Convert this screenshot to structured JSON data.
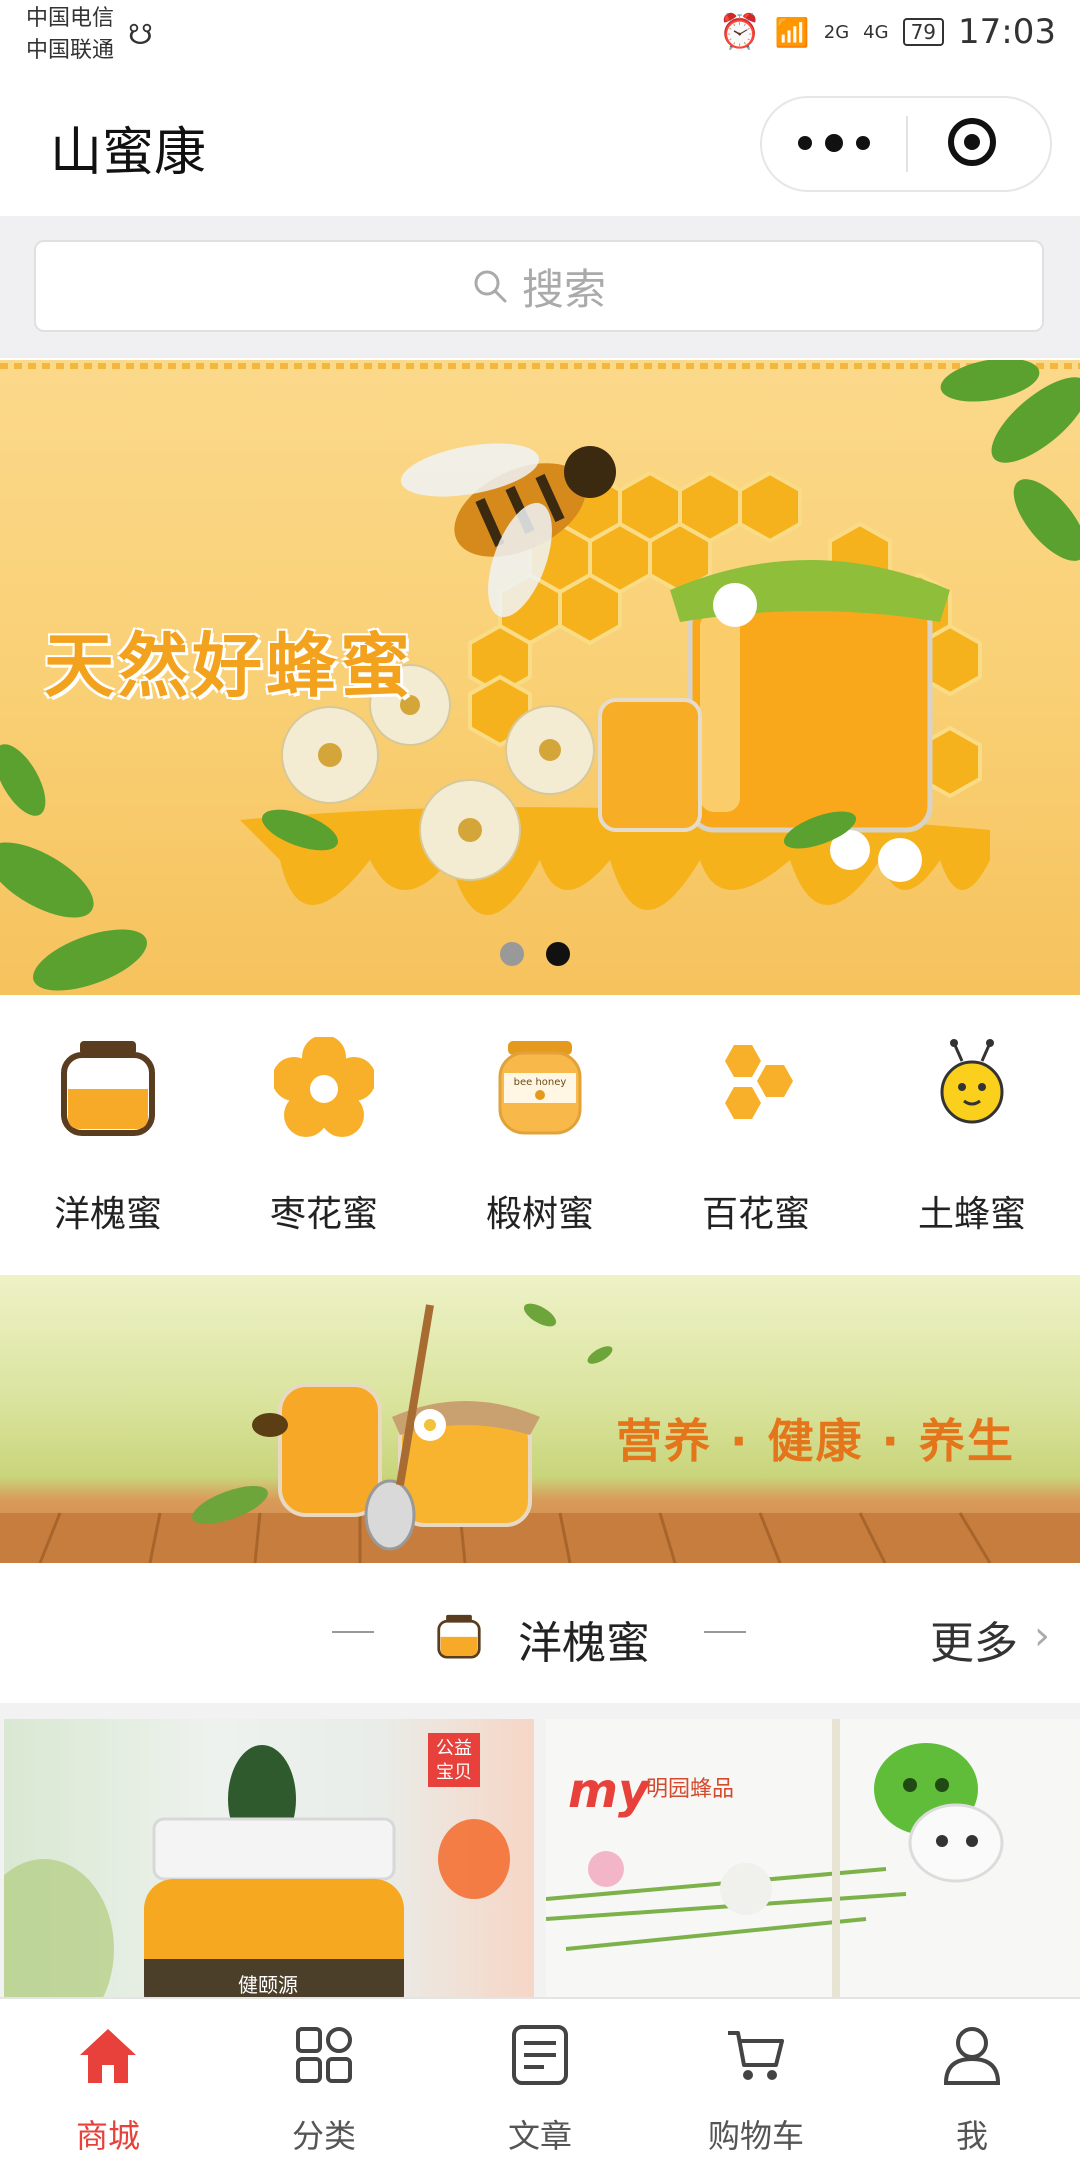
{
  "status_bar": {
    "carrier_1": "中国电信",
    "carrier_2": "中国联通",
    "signal_1": "2G",
    "signal_2": "4G",
    "battery": "79",
    "time": "17:03"
  },
  "title_bar": {
    "title": "山蜜康",
    "menu_icon": "more-dots-icon",
    "close_icon": "target-circle-icon"
  },
  "search": {
    "placeholder": "搜索"
  },
  "banner": {
    "headline": "天然好蜂蜜",
    "slide_count": 2,
    "active_slide": 2
  },
  "categories": [
    {
      "label": "洋槐蜜",
      "icon": "honey-jar-icon"
    },
    {
      "label": "枣花蜜",
      "icon": "flower-icon"
    },
    {
      "label": "椴树蜜",
      "icon": "bee-honey-jar-icon"
    },
    {
      "label": "百花蜜",
      "icon": "honeycomb-icon"
    },
    {
      "label": "土蜂蜜",
      "icon": "bee-face-icon"
    }
  ],
  "promo": {
    "text": "营养 · 健康 · 养生"
  },
  "section": {
    "title": "洋槐蜜",
    "more": "更多"
  },
  "products": [
    {
      "badge": "公益宝贝",
      "label": "健颐源"
    },
    {
      "brand": "my",
      "brand_sub": "明园蜂品"
    }
  ],
  "tab_bar": [
    {
      "label": "商城",
      "icon": "home-icon",
      "active": true
    },
    {
      "label": "分类",
      "icon": "grid-icon",
      "active": false
    },
    {
      "label": "文章",
      "icon": "document-icon",
      "active": false
    },
    {
      "label": "购物车",
      "icon": "cart-icon",
      "active": false
    },
    {
      "label": "我",
      "icon": "user-icon",
      "active": false
    }
  ],
  "colors": {
    "accent": "#e8413b",
    "honey": "#f8b02a",
    "banner_bg": "#fbd98b"
  }
}
